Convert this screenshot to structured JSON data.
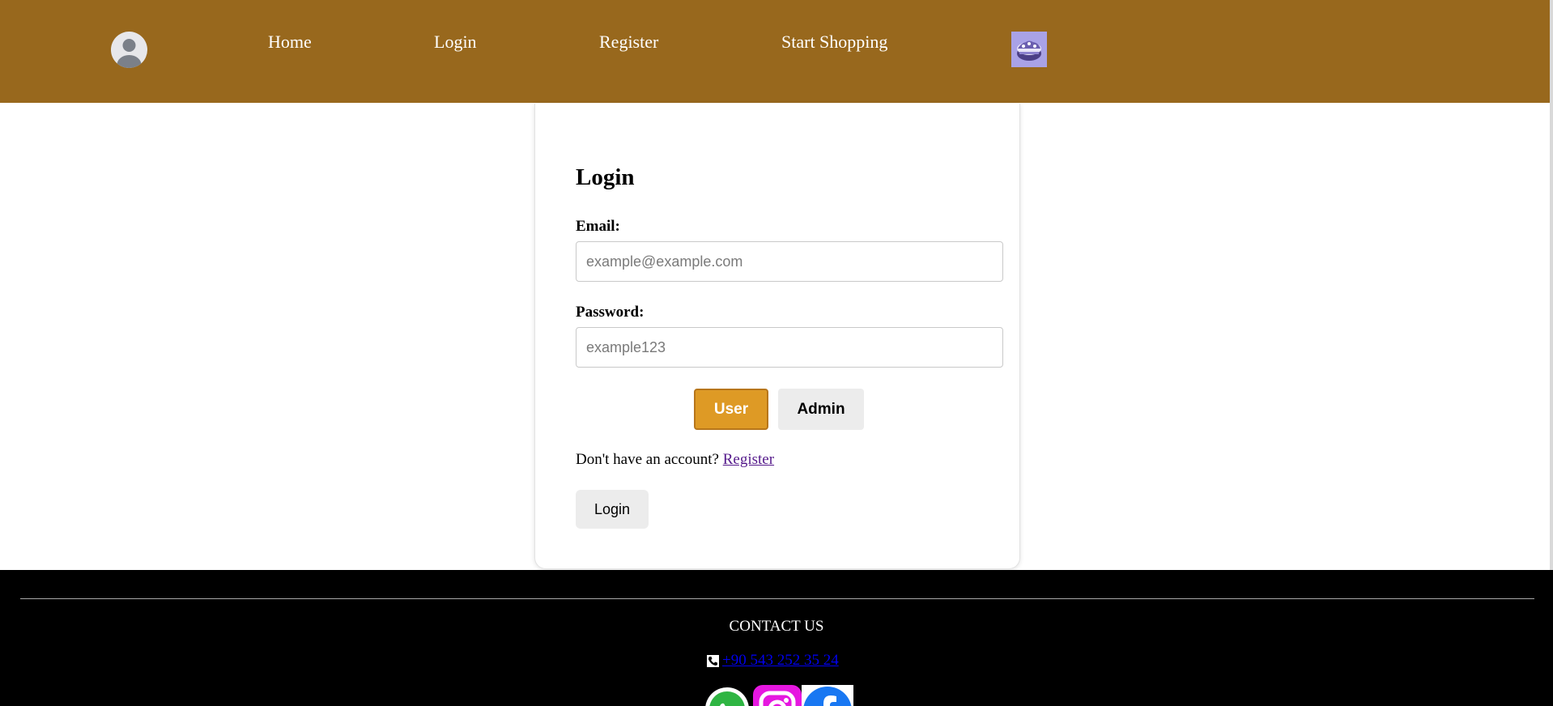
{
  "header": {
    "nav": {
      "home": "Home",
      "login": "Login",
      "register": "Register",
      "shop": "Start Shopping"
    },
    "icons": {
      "avatar": "user-avatar-icon",
      "logo": "cake-logo-icon"
    },
    "background_color": "#98681d"
  },
  "login_form": {
    "title": "Login",
    "email_label": "Email:",
    "email_placeholder": "example@example.com",
    "email_value": "",
    "password_label": "Password:",
    "password_placeholder": "example123",
    "password_value": "",
    "roles": {
      "user": "User",
      "admin": "Admin",
      "selected": "user"
    },
    "no_account_text": "Don't have an account?",
    "register_link": "Register",
    "submit_label": "Login",
    "accent_color": "#de9a25"
  },
  "footer": {
    "contact_heading": "CONTACT US",
    "phone": "+90 543 252 35 24",
    "icons": {
      "phone": "phone-icon",
      "social": [
        "whatsapp-icon",
        "instagram-icon",
        "facebook-icon"
      ]
    }
  }
}
